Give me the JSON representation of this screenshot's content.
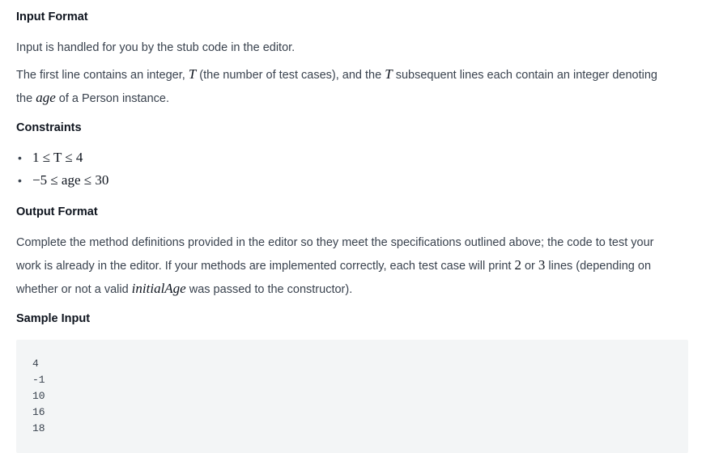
{
  "input_format": {
    "heading": "Input Format",
    "para1": "Input is handled for you by the stub code in the editor.",
    "para2_a": "The first line contains an integer, ",
    "para2_T1": "T",
    "para2_b": " (the number of test cases), and the ",
    "para2_T2": "T",
    "para2_c": " subsequent lines each contain an integer denoting",
    "para2_d": "the ",
    "para2_age": "age",
    "para2_e": " of a Person instance."
  },
  "constraints": {
    "heading": "Constraints",
    "items": [
      {
        "bullet": "•",
        "math": "1 ≤ T ≤ 4"
      },
      {
        "bullet": "•",
        "math": "−5 ≤ age ≤ 30"
      }
    ]
  },
  "output_format": {
    "heading": "Output Format",
    "line1": "Complete the method definitions provided in the editor so they meet the specifications outlined above; the code to test your",
    "line2_a": "work is already in the editor. If your methods are implemented correctly, each test case will print ",
    "line2_n1": "2",
    "line2_b": " or ",
    "line2_n2": "3",
    "line2_c": " lines (depending on",
    "line3_a": "whether or not a valid ",
    "line3_var": "initialAge",
    "line3_b": " was passed to the constructor)."
  },
  "sample_input": {
    "heading": "Sample Input",
    "lines": [
      "4",
      "-1",
      "10",
      "16",
      "18"
    ]
  }
}
